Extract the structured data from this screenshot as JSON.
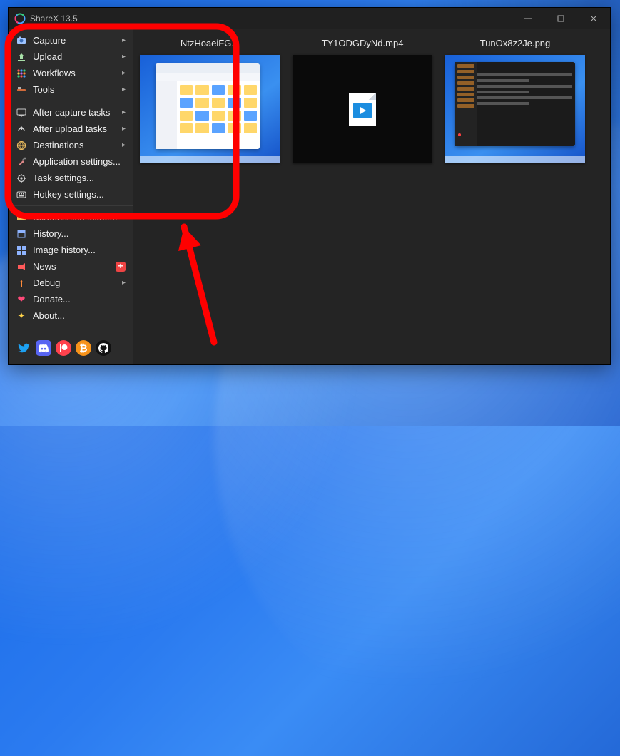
{
  "window": {
    "title": "ShareX 13.5"
  },
  "sidebar": {
    "groups": [
      [
        {
          "icon": "camera-icon",
          "label": "Capture",
          "submenu": true
        },
        {
          "icon": "upload-icon",
          "label": "Upload",
          "submenu": true
        },
        {
          "icon": "workflows-icon",
          "label": "Workflows",
          "submenu": true
        },
        {
          "icon": "tools-icon",
          "label": "Tools",
          "submenu": true
        }
      ],
      [
        {
          "icon": "after-capture-icon",
          "label": "After capture tasks",
          "submenu": true
        },
        {
          "icon": "after-upload-icon",
          "label": "After upload tasks",
          "submenu": true
        },
        {
          "icon": "destinations-icon",
          "label": "Destinations",
          "submenu": true
        },
        {
          "icon": "settings-icon",
          "label": "Application settings..."
        },
        {
          "icon": "task-settings-icon",
          "label": "Task settings..."
        },
        {
          "icon": "hotkey-icon",
          "label": "Hotkey settings..."
        }
      ],
      [
        {
          "icon": "folder-icon",
          "label": "Screenshots folder..."
        },
        {
          "icon": "history-icon",
          "label": "History..."
        },
        {
          "icon": "image-history-icon",
          "label": "Image history..."
        },
        {
          "icon": "news-icon",
          "label": "News",
          "badge": "+"
        },
        {
          "icon": "debug-icon",
          "label": "Debug",
          "submenu": true
        },
        {
          "icon": "donate-icon",
          "label": "Donate..."
        },
        {
          "icon": "about-icon",
          "label": "About..."
        }
      ]
    ],
    "social": [
      "twitter-icon",
      "discord-icon",
      "patreon-icon",
      "bitcoin-icon",
      "github-icon"
    ]
  },
  "thumbnails": [
    {
      "name": "NtzHoaeiFG.g",
      "kind": "desktop-explorer"
    },
    {
      "name": "TY1ODGDyNd.mp4",
      "kind": "video-file"
    },
    {
      "name": "TunOx8z2Je.png",
      "kind": "desktop-dark"
    }
  ],
  "annotation": {
    "highlight_box": true,
    "arrow": true,
    "color": "#ff0000"
  }
}
